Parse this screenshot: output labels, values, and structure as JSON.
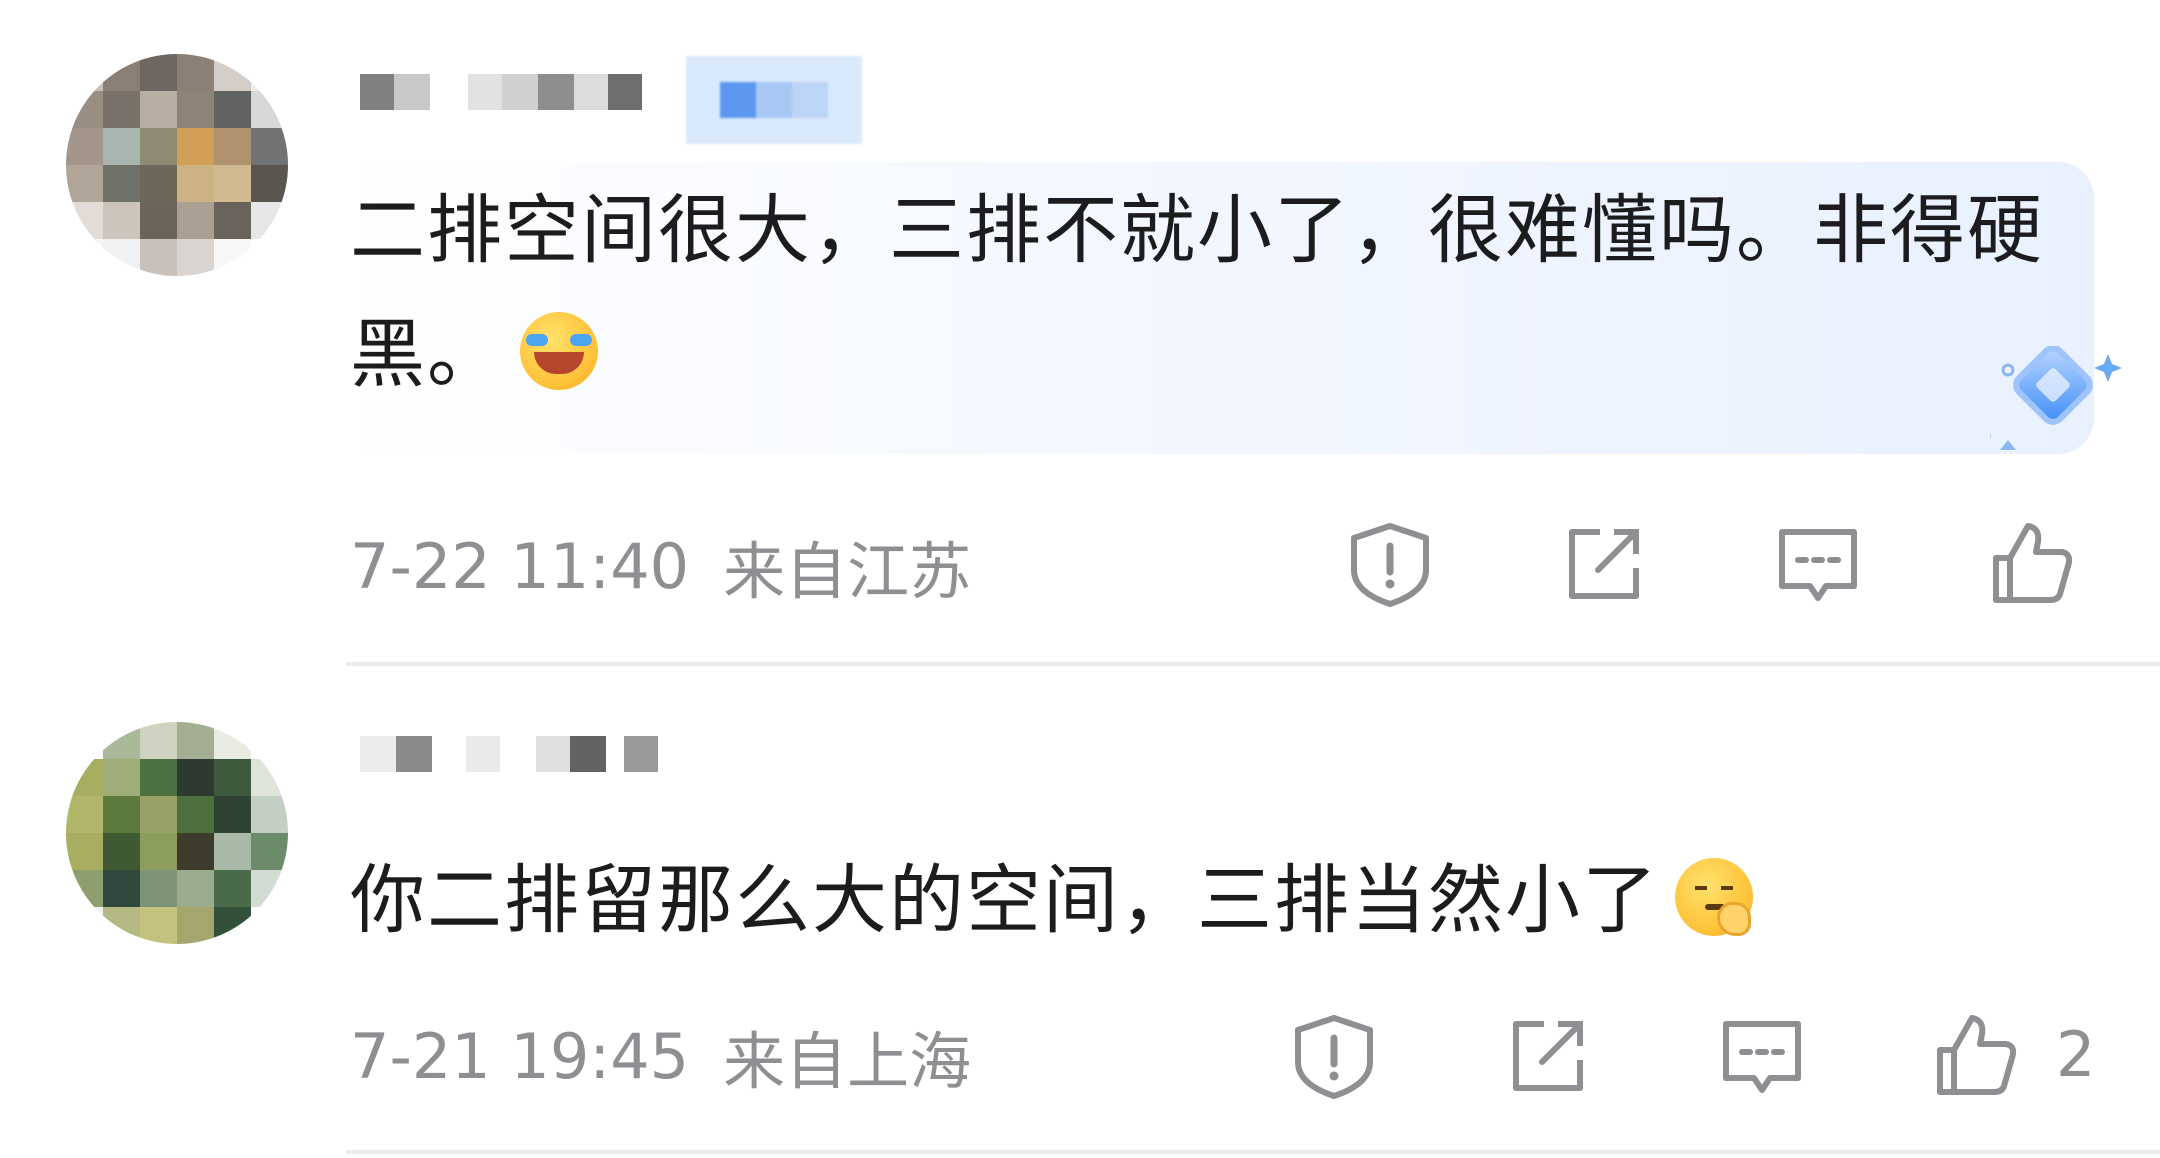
{
  "comments": [
    {
      "content": "二排空间很大，三排不就小了，很难懂吗。非得硬黑。",
      "emoji": "laugh-cry-emoji",
      "time": "7-22 11:40",
      "location": "来自江苏",
      "likes": ""
    },
    {
      "content": "你二排留那么大的空间，三排当然小了",
      "emoji": "shush-emoji",
      "time": "7-21 19:45",
      "location": "来自上海",
      "likes": "2"
    }
  ],
  "icons": {
    "report": "shield-alert-icon",
    "share": "share-external-icon",
    "reply": "comment-bubble-icon",
    "like": "thumbs-up-icon"
  },
  "colors": {
    "meta_text": "#8e8e93",
    "highlight_card": "#e9f1ff",
    "divider": "#ebebed",
    "accent": "#3d8bf5"
  }
}
